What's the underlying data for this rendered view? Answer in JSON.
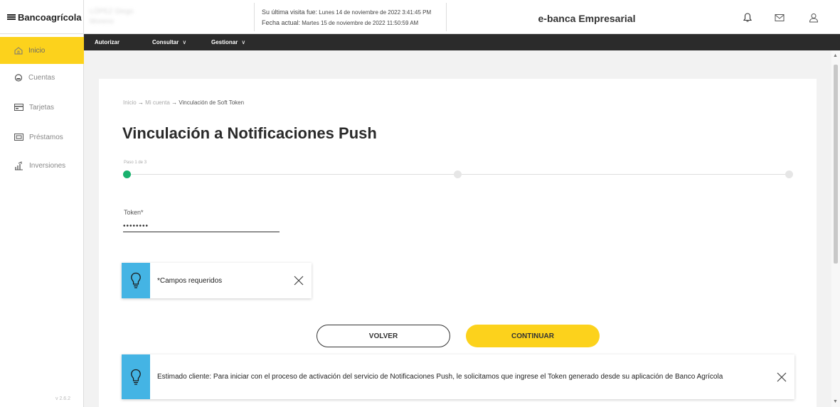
{
  "header": {
    "logo_text": "Bancoagrícola",
    "user_name": "LÓPEZ Diego Moreno",
    "last_visit": "Su última visita fue:",
    "last_visit_value": "Lunes 14 de noviembre de 2022 3:41:45 PM",
    "current_date": "Fecha actual:",
    "current_date_value": "Martes 15 de noviembre de 2022 11:50:59 AM",
    "brand": "e-banca Empresarial",
    "icons": [
      "bell-icon",
      "mail-icon",
      "user-icon"
    ]
  },
  "nav": {
    "items": [
      {
        "label": "Autorizar"
      },
      {
        "label": "Consultar",
        "chevron": "∨"
      },
      {
        "label": "Gestionar",
        "chevron": "∨"
      }
    ]
  },
  "sidebar": {
    "items": [
      {
        "label": "Inicio",
        "icon": "home-icon",
        "active": true
      },
      {
        "label": "Cuentas",
        "icon": "piggy-bank-icon"
      },
      {
        "label": "Tarjetas",
        "icon": "card-icon"
      },
      {
        "label": "Préstamos",
        "icon": "loan-icon"
      },
      {
        "label": "Inversiones",
        "icon": "investment-icon"
      }
    ],
    "version": "v 2.6.2"
  },
  "main": {
    "breadcrumb": {
      "home": "Inicio",
      "account": "Mi cuenta",
      "current": "Vinculación de Soft Token",
      "separator": "→"
    },
    "title": "Vinculación a Notificaciones Push",
    "step_label": "Paso 1 de 3",
    "token": {
      "label": "Token*",
      "value": "••••••••"
    },
    "required_note": "*Campos requeridos",
    "back_button": "VOLVER",
    "continue_button": "CONTINUAR",
    "info_message": "Estimado cliente: Para iniciar con el proceso de activación del servicio de Notificaciones Push, le solicitamos que ingrese el Token generado desde su aplicación de Banco Agrícola"
  },
  "colors": {
    "accent_yellow": "#fcd21c",
    "info_blue": "#44b4e4",
    "step_green": "#19b16e",
    "nav_dark": "#2b2b2b"
  }
}
